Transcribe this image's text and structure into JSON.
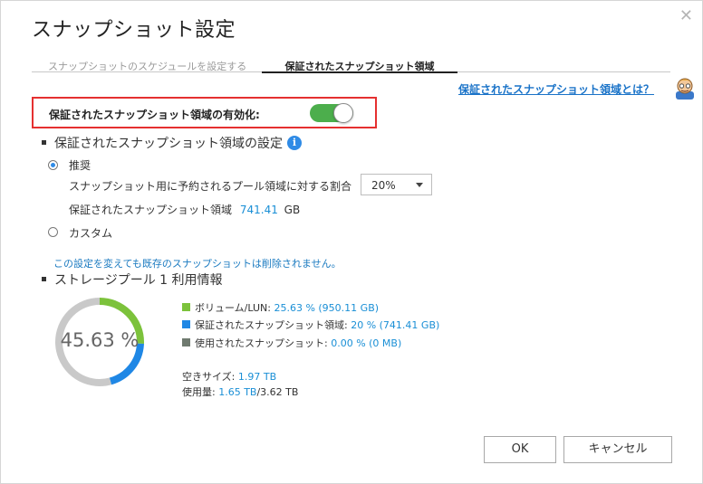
{
  "dialog": {
    "title": "スナップショット設定",
    "close_glyph": "✕"
  },
  "tabs": [
    {
      "label": "スナップショットのスケジュールを設定する",
      "active": false
    },
    {
      "label": "保証されたスナップショット領域",
      "active": true
    }
  ],
  "help": {
    "link_text": "保証されたスナップショット領域とは？",
    "icon": "help-character-icon"
  },
  "enable": {
    "label": "保証されたスナップショット領域の有効化:",
    "toggle_on": true
  },
  "settings": {
    "heading": "保証されたスナップショット領域の設定",
    "info_glyph": "i",
    "recommended": {
      "label": "推奨",
      "selected": true,
      "ratio_label": "スナップショット用に予約されるプール領域に対する割合",
      "ratio_value": "20%",
      "guaranteed_label": "保証されたスナップショット領域",
      "guaranteed_value": "741.41",
      "guaranteed_unit": "GB"
    },
    "custom": {
      "label": "カスタム",
      "selected": false
    },
    "note": "この設定を変えても既存のスナップショットは削除されません。"
  },
  "pool": {
    "heading": "ストレージプール 1 利用情報",
    "donut_label": "45.63 %",
    "legend": [
      {
        "label": "ボリューム/LUN: ",
        "value": "25.63 % (950.11 GB)",
        "color": "#7cc23b"
      },
      {
        "label": "保証されたスナップショット領域: ",
        "value": "20 % (741.41 GB)",
        "color": "#1f87e5"
      },
      {
        "label": "使用されたスナップショット: ",
        "value": "0.00 % (0 MB)",
        "color": "#6f7a6f"
      }
    ],
    "free_label": "空きサイズ: ",
    "free_value": "1.97 TB",
    "used_label": "使用量: ",
    "used_value": "1.65 TB",
    "total_value": "/3.62 TB",
    "segments": [
      {
        "name": "volume-lun",
        "percent": 25.63,
        "color": "#7cc23b"
      },
      {
        "name": "guaranteed-snapshot",
        "percent": 20,
        "color": "#1f87e5"
      },
      {
        "name": "free",
        "percent": 54.37,
        "color": "#c9c9c9"
      }
    ]
  },
  "buttons": {
    "ok": "OK",
    "cancel": "キャンセル"
  }
}
